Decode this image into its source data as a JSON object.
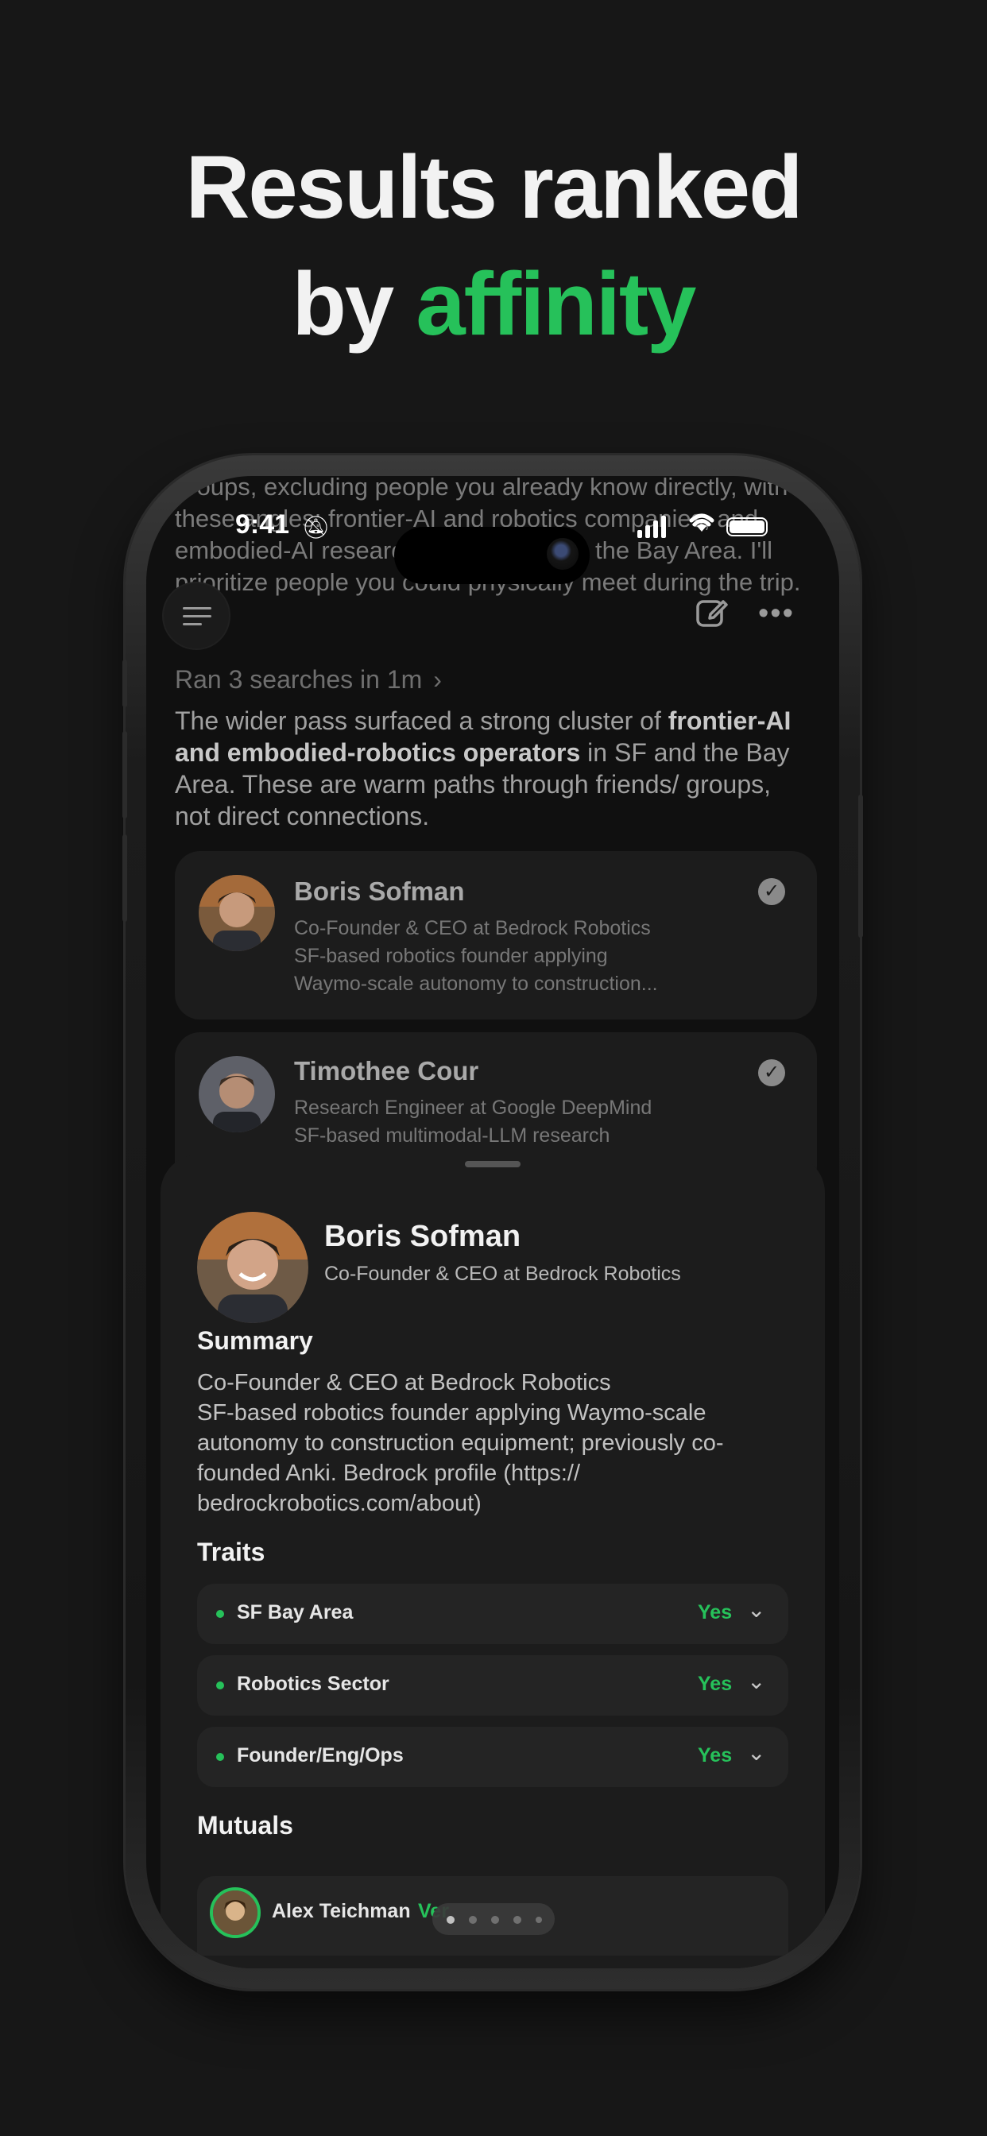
{
  "headline": {
    "line1": "Results ranked",
    "line2_prefix": "by",
    "line2_accent": "affinity"
  },
  "status_bar": {
    "time": "9:41"
  },
  "chat": {
    "previous_text": "groups, excluding people you already know directly, with these angles: frontier-AI and robotics companies, and embodied-AI researchers/operators in the Bay Area. I'll prioritize people you could physically meet during the trip.",
    "search_summary": "Ran 3 searches in 1m",
    "para_pre": "The wider pass surfaced a strong cluster of ",
    "para_bold": "frontier-AI and embodied-robotics operators",
    "para_post": " in SF and the Bay Area. These are warm paths through friends/ groups, not direct connections.",
    "results": [
      {
        "name": "Boris Sofman",
        "line1": "Co-Founder & CEO at Bedrock Robotics",
        "line2": "SF-based robotics founder applying",
        "line3": "Waymo-scale autonomy to construction..."
      },
      {
        "name": "Timothee Cour",
        "line1": "Research Engineer at Google DeepMind",
        "line2": "SF-based multimodal-LLM research",
        "line3": ""
      }
    ]
  },
  "profile": {
    "name": "Boris Sofman",
    "role": "Co-Founder & CEO at Bedrock Robotics",
    "summary_heading": "Summary",
    "summary_line1": "Co-Founder & CEO at Bedrock Robotics",
    "summary_rest": "SF-based robotics founder applying Waymo-scale autonomy to construction equipment; previously co-founded Anki. Bedrock profile (https:// bedrockrobotics.com/about)",
    "traits_heading": "Traits",
    "traits": [
      {
        "label": "SF Bay Area",
        "value": "Yes"
      },
      {
        "label": "Robotics Sector",
        "value": "Yes"
      },
      {
        "label": "Founder/Eng/Ops",
        "value": "Yes"
      }
    ],
    "mutuals_heading": "Mutuals",
    "mutuals": [
      {
        "name": "Alex Teichman",
        "tag": "Ver"
      }
    ]
  },
  "pager": {
    "current": 1,
    "total": 5
  },
  "colors": {
    "accent": "#26c15a",
    "background": "#171717",
    "sheet": "#1c1c1c"
  }
}
